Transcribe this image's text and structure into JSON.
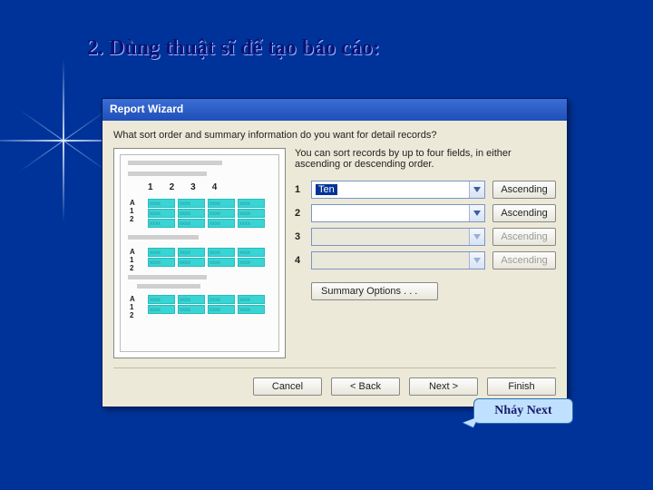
{
  "slide": {
    "heading": "2. Dùng thuật sĩ để tạo báo cáo:"
  },
  "window": {
    "title": "Report Wizard",
    "prompt": "What sort order and summary information do you want for detail records?",
    "hint": "You can sort records by up to four fields, in either ascending or descending order.",
    "preview_headers": [
      "1",
      "2",
      "3",
      "4"
    ],
    "sort_rows": [
      {
        "num": "1",
        "value": "Ten",
        "btn": "Ascending",
        "enabled": true
      },
      {
        "num": "2",
        "value": "",
        "btn": "Ascending",
        "enabled": true
      },
      {
        "num": "3",
        "value": "",
        "btn": "Ascending",
        "enabled": false
      },
      {
        "num": "4",
        "value": "",
        "btn": "Ascending",
        "enabled": false
      }
    ],
    "summary_btn": "Summary Options . . .",
    "buttons": {
      "cancel": "Cancel",
      "back": "< Back",
      "next": "Next >",
      "finish": "Finish"
    }
  },
  "callout": {
    "text": "Nháy Next"
  }
}
